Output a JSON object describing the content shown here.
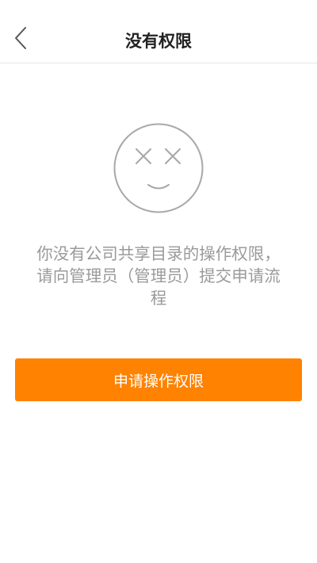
{
  "header": {
    "title": "没有权限",
    "back_icon": "chevron-left-icon"
  },
  "empty_state": {
    "icon": "sad-face-icon",
    "message": "你没有公司共享目录的操作权限，请向管理员（管理员）提交申请流程"
  },
  "actions": {
    "apply_label": "申请操作权限"
  },
  "colors": {
    "accent": "#ff8200",
    "message_text": "#9a9a9a",
    "icon_stroke": "#a8a8a8"
  }
}
